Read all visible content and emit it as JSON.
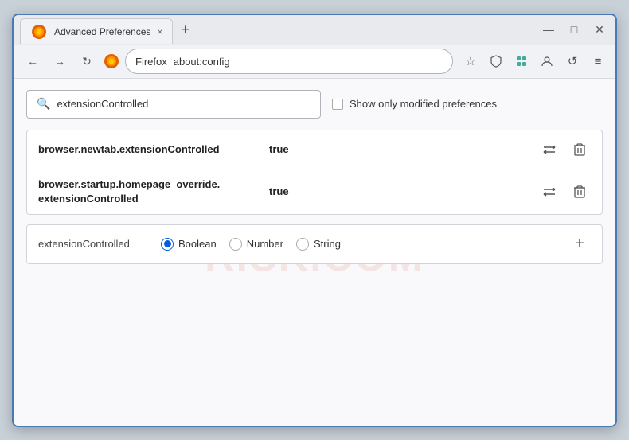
{
  "window": {
    "title": "Advanced Preferences",
    "tab_close": "×",
    "tab_add": "+",
    "win_minimize": "—",
    "win_maximize": "□",
    "win_close": "✕"
  },
  "navbar": {
    "back_tooltip": "Back",
    "forward_tooltip": "Forward",
    "reload_tooltip": "Reload",
    "browser_name": "Firefox",
    "address": "about:config"
  },
  "toolbar_icons": [
    "☆",
    "⛉",
    "⊞",
    "✉",
    "↺",
    "≡"
  ],
  "search": {
    "placeholder": "extensionControlled",
    "value": "extensionControlled",
    "checkbox_label": "Show only modified preferences"
  },
  "results": [
    {
      "name": "browser.newtab.extensionControlled",
      "value": "true"
    },
    {
      "name": "browser.startup.homepage_override.\nextensionControlled",
      "name_line1": "browser.startup.homepage_override.",
      "name_line2": "extensionControlled",
      "value": "true",
      "multiline": true
    }
  ],
  "new_pref": {
    "name": "extensionControlled",
    "types": [
      "Boolean",
      "Number",
      "String"
    ],
    "selected_type": "Boolean",
    "add_btn": "+"
  },
  "watermark": "RISK.COM"
}
